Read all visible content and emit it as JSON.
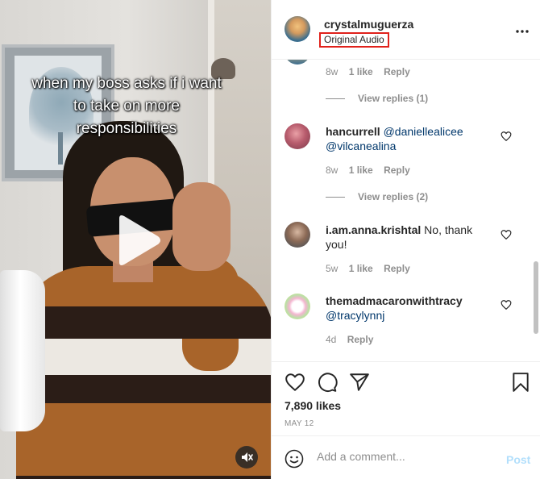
{
  "media": {
    "caption_lines": [
      "when my boss asks if i want",
      "to take on more",
      "responsibilities"
    ],
    "play_icon": "play-icon",
    "mute_icon": "speaker-muted-icon"
  },
  "header": {
    "username": "crystalmuguerza",
    "audio_label": "Original Audio",
    "more_icon": "more-horizontal-icon",
    "highlight_color": "#e0211b"
  },
  "comments": {
    "first_meta": {
      "age": "8w",
      "likes": "1 like",
      "reply": "Reply"
    },
    "first_view_replies": "View replies (1)",
    "items": [
      {
        "username": "hancurrell",
        "mentions": [
          "@daniellealicee",
          "@vilcanealina"
        ],
        "age": "8w",
        "likes": "1 like",
        "reply": "Reply",
        "view_replies": "View replies (2)"
      },
      {
        "username": "i.am.anna.krishtal",
        "text": "No, thank you!",
        "age": "5w",
        "likes": "1 like",
        "reply": "Reply"
      },
      {
        "username": "themadmacaronwithtracy",
        "mentions": [
          "@tracylynnj"
        ],
        "age": "4d",
        "reply": "Reply"
      }
    ]
  },
  "actions": {
    "like_icon": "heart-icon",
    "comment_icon": "comment-icon",
    "share_icon": "send-icon",
    "save_icon": "bookmark-icon",
    "likes_count": "7,890 likes",
    "date": "MAY 12"
  },
  "add_comment": {
    "emoji_icon": "emoji-icon",
    "placeholder": "Add a comment...",
    "post_label": "Post"
  },
  "colors": {
    "link": "#00376b",
    "muted": "#8e8e8e",
    "post_disabled": "#b2dffc"
  }
}
